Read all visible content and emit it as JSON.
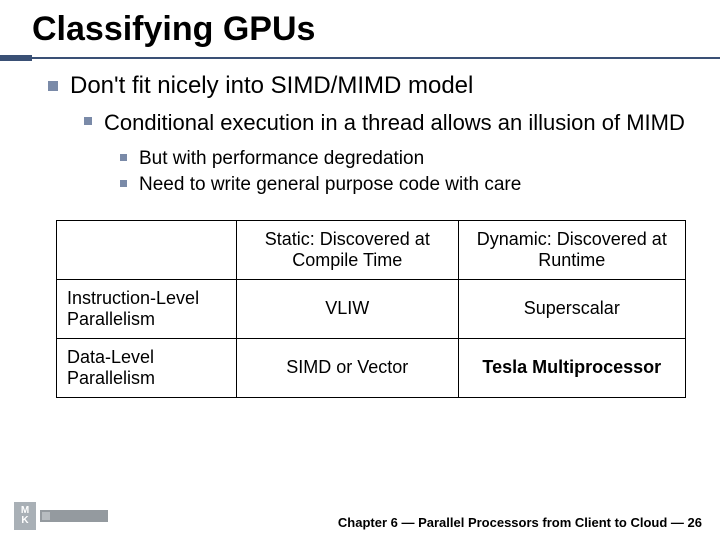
{
  "title": "Classifying GPUs",
  "bullets": {
    "lvl1": "Don't fit nicely into SIMD/MIMD model",
    "lvl2": "Conditional execution in a thread allows an illusion of MIMD",
    "lvl3a": "But with performance degredation",
    "lvl3b": "Need to write general purpose code with care"
  },
  "table": {
    "col1": "Static: Discovered at Compile Time",
    "col2": "Dynamic: Discovered at Runtime",
    "row1_head": "Instruction-Level Parallelism",
    "row1_c1": "VLIW",
    "row1_c2": "Superscalar",
    "row2_head": "Data-Level Parallelism",
    "row2_c1": "SIMD or Vector",
    "row2_c2": "Tesla Multiprocessor"
  },
  "logo": {
    "line1": "M",
    "line2": "K"
  },
  "footer": "Chapter 6 — Parallel Processors from Client to Cloud — 26"
}
